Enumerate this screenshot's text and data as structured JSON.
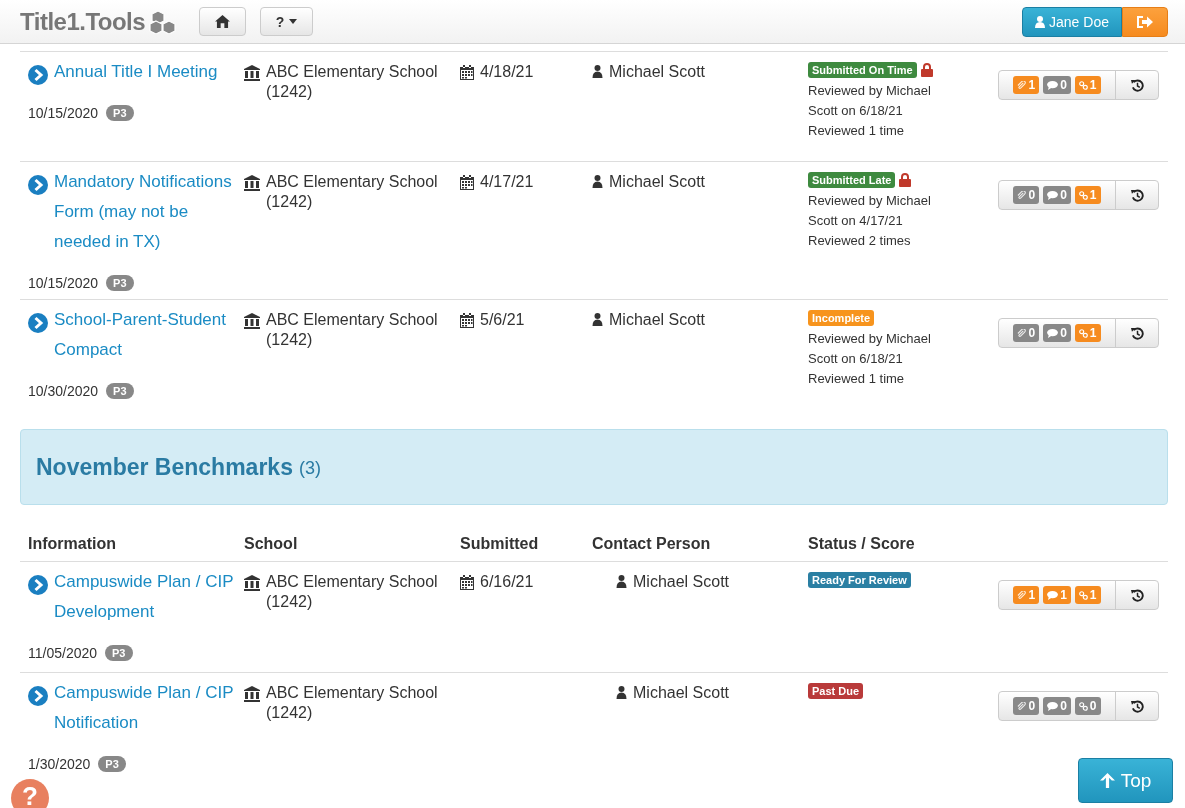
{
  "header": {
    "brand": "Title1.Tools",
    "help_menu": "?",
    "user": "Jane Doe"
  },
  "sections": [
    {
      "rows": [
        {
          "title": "Annual Title I Meeting",
          "date": "10/15/2020",
          "priority": "P3",
          "school": "ABC Elementary School",
          "school_code": "(1242)",
          "submitted": "4/18/21",
          "contact": "Michael Scott",
          "status": {
            "label": "Submitted On Time",
            "kind": "success"
          },
          "locked": true,
          "notes": [
            "Reviewed by Michael Scott on 6/18/21",
            "Reviewed 1 time"
          ],
          "counts": [
            {
              "count": "1",
              "highlighted": true
            },
            {
              "count": "0",
              "highlighted": false
            },
            {
              "count": "1",
              "highlighted": true
            }
          ]
        },
        {
          "title": "Mandatory Notifications Form (may not be needed in TX)",
          "date": "10/15/2020",
          "priority": "P3",
          "school": "ABC Elementary School",
          "school_code": "(1242)",
          "submitted": "4/17/21",
          "contact": "Michael Scott",
          "status": {
            "label": "Submitted Late",
            "kind": "success"
          },
          "locked": true,
          "notes": [
            "Reviewed by Michael Scott on 4/17/21",
            "Reviewed 2 times"
          ],
          "counts": [
            {
              "count": "0",
              "highlighted": false
            },
            {
              "count": "0",
              "highlighted": false
            },
            {
              "count": "1",
              "highlighted": true
            }
          ]
        },
        {
          "title": "School-Parent-Student Compact",
          "date": "10/30/2020",
          "priority": "P3",
          "school": "ABC Elementary School",
          "school_code": "(1242)",
          "submitted": "5/6/21",
          "contact": "Michael Scott",
          "status": {
            "label": "Incomplete",
            "kind": "warning"
          },
          "locked": false,
          "notes": [
            "Reviewed by Michael Scott on 6/18/21",
            "Reviewed 1 time"
          ],
          "counts": [
            {
              "count": "0",
              "highlighted": false
            },
            {
              "count": "0",
              "highlighted": false
            },
            {
              "count": "1",
              "highlighted": true
            }
          ]
        }
      ]
    },
    {
      "title": "November Benchmarks",
      "count": "(3)",
      "columns": [
        "Information",
        "School",
        "Submitted",
        "Contact Person",
        "Status / Score"
      ],
      "rows": [
        {
          "title": "Campuswide Plan / CIP Development",
          "date": "11/05/2020",
          "priority": "P3",
          "school": "ABC Elementary School",
          "school_code": "(1242)",
          "submitted": "6/16/21",
          "contact": "Michael Scott",
          "status": {
            "label": "Ready For Review",
            "kind": "info"
          },
          "locked": false,
          "counts": [
            {
              "count": "1",
              "highlighted": true
            },
            {
              "count": "1",
              "highlighted": true
            },
            {
              "count": "1",
              "highlighted": true
            }
          ]
        },
        {
          "title": "Campuswide Plan / CIP Notification",
          "date": "1/30/2020",
          "priority": "P3",
          "school": "ABC Elementary School",
          "school_code": "(1242)",
          "contact": "Michael Scott",
          "status": {
            "label": "Past Due",
            "kind": "danger"
          },
          "locked": false,
          "counts": [
            {
              "count": "0",
              "highlighted": false
            },
            {
              "count": "0",
              "highlighted": false
            },
            {
              "count": "0",
              "highlighted": false
            }
          ]
        }
      ]
    }
  ],
  "top_button": "Top",
  "help_bubble": "?"
}
